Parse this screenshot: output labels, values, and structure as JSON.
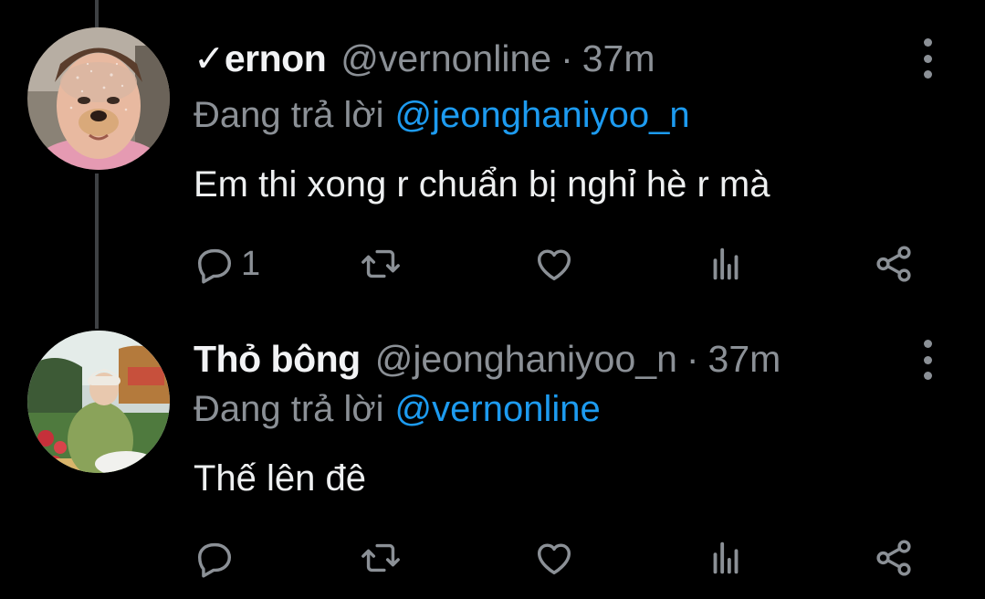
{
  "colors": {
    "background": "#000000",
    "text": "#e7e9ea",
    "muted": "#8b9096",
    "link": "#1d9bf0",
    "thread_line": "#3e4144"
  },
  "tweets": [
    {
      "display_name": "✓ernon",
      "handle": "@vernonline",
      "separator": "·",
      "time": "37m",
      "reply_prefix": "Đang trả lời",
      "reply_to": "@jeonghaniyoo_n",
      "text": "Em thi xong r chuẩn bị nghỉ hè r mà",
      "reply_count": "1",
      "icons": [
        "reply-icon",
        "retweet-icon",
        "like-icon",
        "views-icon",
        "share-icon"
      ]
    },
    {
      "display_name": "Thỏ bông",
      "handle": "@jeonghaniyoo_n",
      "separator": "·",
      "time": "37m",
      "reply_prefix": "Đang trả lời",
      "reply_to": "@vernonline",
      "text": "Thế lên đê",
      "reply_count": "",
      "icons": [
        "reply-icon",
        "retweet-icon",
        "like-icon",
        "views-icon",
        "share-icon"
      ]
    }
  ]
}
